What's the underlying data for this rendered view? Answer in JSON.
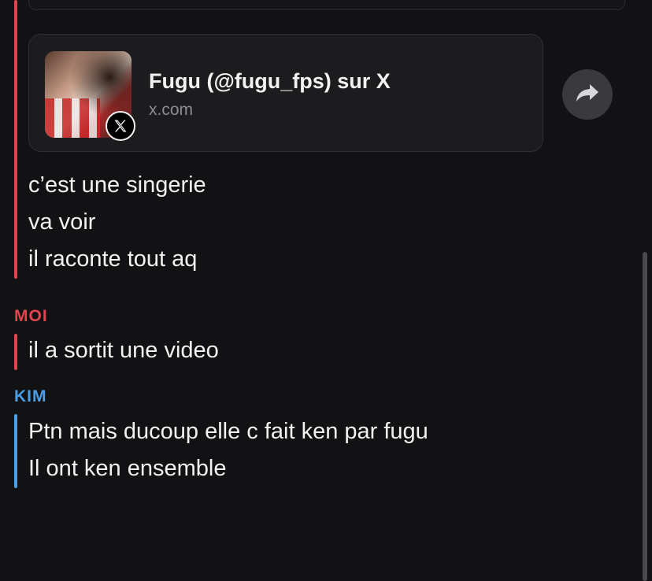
{
  "link_preview": {
    "title": "Fugu (@fugu_fps) sur X",
    "domain": "x.com",
    "thumbnail_icon": "profile-photo",
    "badge_icon": "x-logo-icon"
  },
  "share_icon": "share-arrow-icon",
  "thread": [
    {
      "sender": "",
      "messages": [
        "c’est une singerie",
        "va voir",
        "il raconte tout aq"
      ]
    },
    {
      "sender": "MOI",
      "messages": [
        "il a sortit une video"
      ]
    },
    {
      "sender": "KIM",
      "messages": [
        "Ptn mais ducoup elle c fait ken par fugu",
        "Il ont ken ensemble"
      ]
    }
  ],
  "colors": {
    "background": "#121214",
    "me_accent": "#e0454f",
    "kim_accent": "#4a9fe6",
    "card": "#1c1c1e"
  }
}
